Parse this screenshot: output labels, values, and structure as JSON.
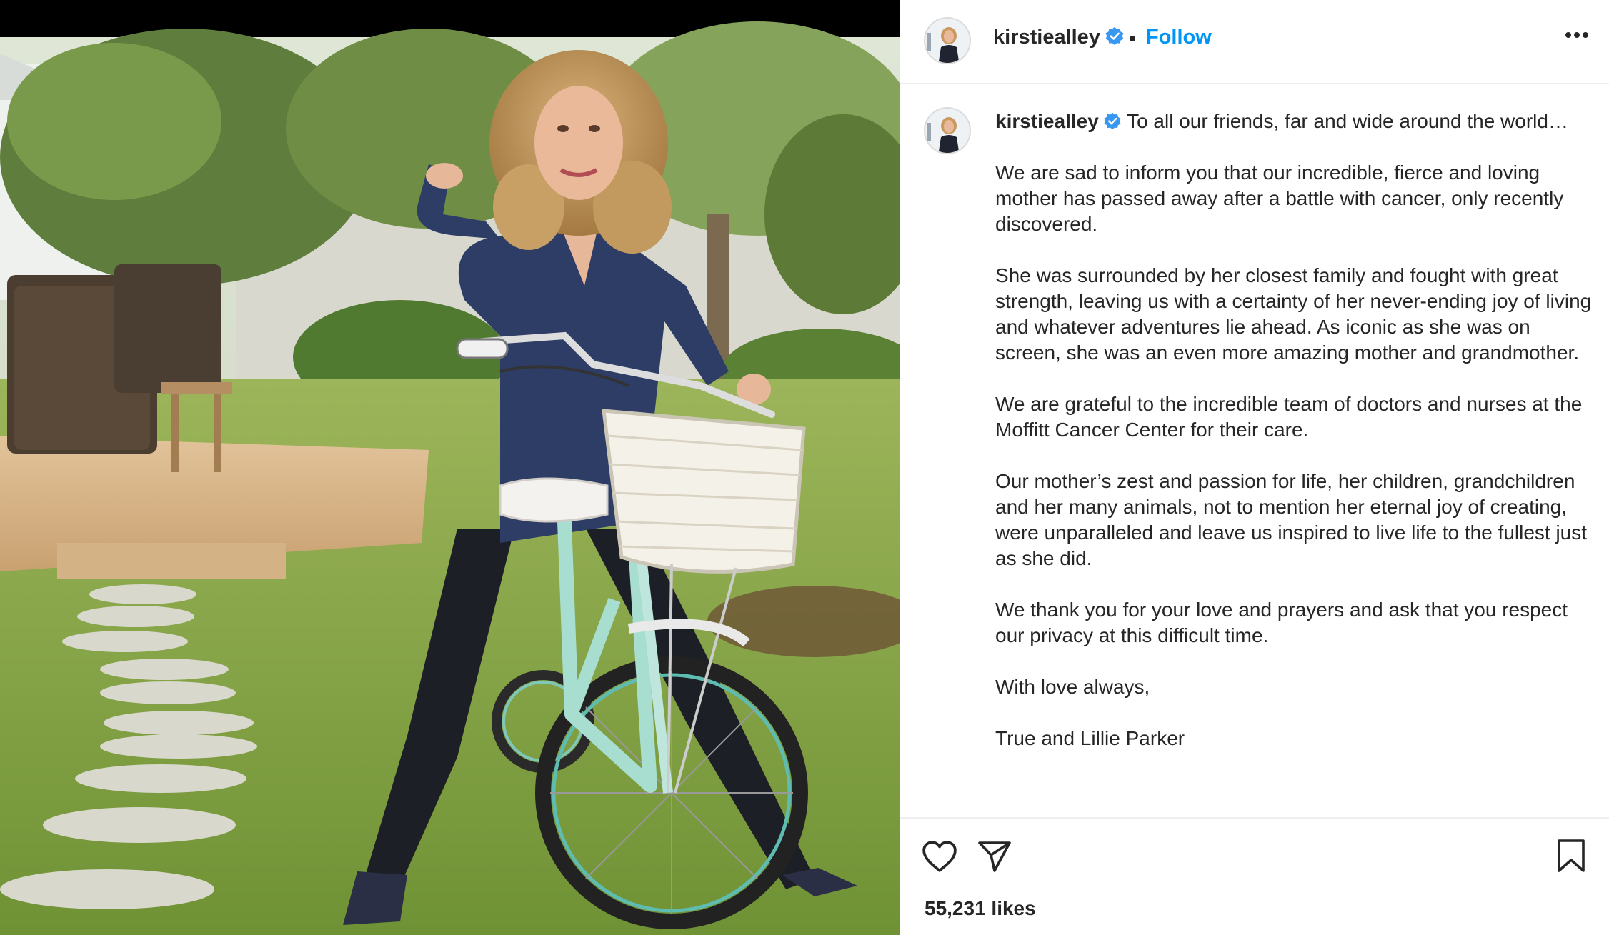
{
  "post": {
    "username": "kirstiealley",
    "verified": true,
    "follow_label": "Follow",
    "separator": "•",
    "caption_first_line": "To all our friends, far and wide around the world…",
    "caption_paragraphs": [
      "We are sad to inform you that our incredible, fierce and loving mother has passed away after a battle with cancer, only recently discovered.",
      "She was surrounded by her closest family and fought with great strength, leaving us with a certainty of her never-ending joy of living and whatever adventures lie ahead. As iconic as she was on screen, she was an even more amazing mother and grandmother.",
      "We are grateful to the incredible team of doctors and nurses at the Moffitt Cancer Center for their care.",
      "Our mother’s zest and passion for life, her children, grandchildren and her many animals, not to mention her eternal joy of creating, were unparalleled and leave us inspired to live life to the fullest just as she did.",
      "We thank you for your love and prayers and ask that you respect our privacy at this difficult time.",
      "With love always,",
      "True and Lillie Parker"
    ],
    "likes": "55,231 likes"
  },
  "icons": {
    "verified": "verified-badge-icon",
    "more": "more-options-icon",
    "like": "heart-icon",
    "share": "send-icon",
    "save": "bookmark-icon"
  },
  "colors": {
    "accent": "#0095f6",
    "verified": "#3897f0",
    "text": "#262626",
    "divider": "#efefef"
  }
}
